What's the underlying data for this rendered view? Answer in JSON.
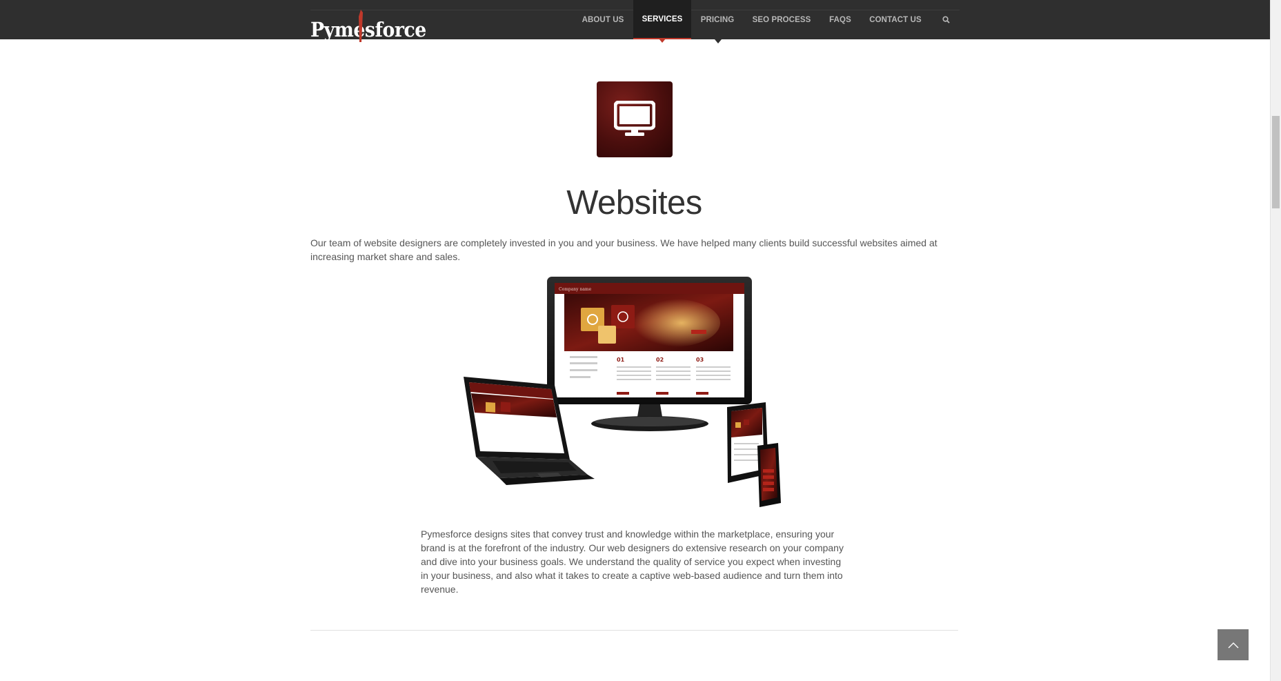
{
  "brand": {
    "logo_text": "Pymesforce",
    "accent": "#c0392b",
    "nav_bg": "#2f2f2f"
  },
  "nav": {
    "items": [
      {
        "label": "ABOUT US"
      },
      {
        "label": "SERVICES"
      },
      {
        "label": "PRICING"
      },
      {
        "label": "SEO PROCESS"
      },
      {
        "label": "FAQS"
      },
      {
        "label": "CONTACT US"
      }
    ],
    "active": "SERVICES",
    "search_icon": "search-icon"
  },
  "section": {
    "icon": "monitor-icon",
    "title": "Websites",
    "intro": "Our team of website designers are completely invested in you and your business. We have helped many clients build successful websites aimed at increasing market share and sales.",
    "hero_icon": "responsive-devices-illustration",
    "body": "Pymesforce designs sites that convey trust and knowledge within the marketplace, ensuring your brand is at the forefront of the industry. Our web designers do extensive research on your company and dive into your business goals. We understand the quality of service you expect when investing in your business, and also what it takes to create a captive web-based audience and turn them into revenue."
  },
  "back_to_top_icon": "chevron-up-icon"
}
